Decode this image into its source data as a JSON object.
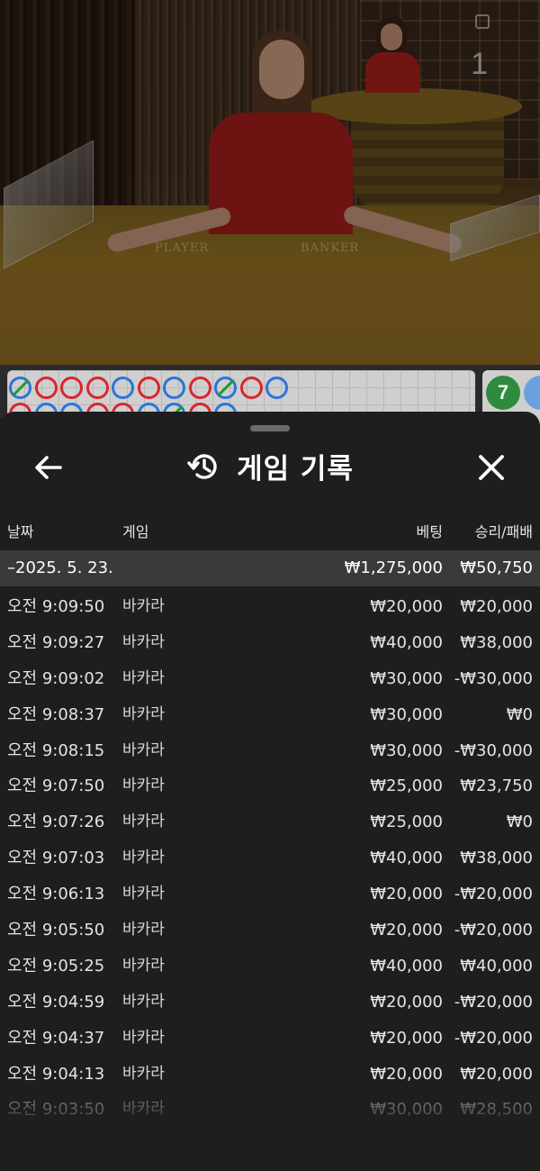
{
  "video": {
    "table_number": "1",
    "felt_labels": [
      "PLAYER",
      "BANKER"
    ]
  },
  "roadmap": {
    "row1": [
      "b",
      "r",
      "r",
      "r",
      "b",
      "r",
      "b",
      "r",
      "b",
      "r",
      "b"
    ],
    "row2": [
      "r",
      "b",
      "b",
      "r",
      "r",
      "b",
      "b",
      "r",
      "b"
    ],
    "side_badge": "7"
  },
  "sheet": {
    "title": "게임 기록",
    "icons": {
      "back": "arrow-left-icon",
      "history": "history-icon",
      "close": "close-icon"
    },
    "columns": {
      "date": "날짜",
      "game": "게임",
      "bet": "베팅",
      "result": "승리/패배"
    },
    "date_group": {
      "label": "–2025. 5. 23.",
      "bet": "₩1,275,000",
      "result": "₩50,750"
    },
    "rows": [
      {
        "time": "오전 9:09:50",
        "game": "바카라",
        "bet": "₩20,000",
        "result": "₩20,000"
      },
      {
        "time": "오전 9:09:27",
        "game": "바카라",
        "bet": "₩40,000",
        "result": "₩38,000"
      },
      {
        "time": "오전 9:09:02",
        "game": "바카라",
        "bet": "₩30,000",
        "result": "-₩30,000"
      },
      {
        "time": "오전 9:08:37",
        "game": "바카라",
        "bet": "₩30,000",
        "result": "₩0"
      },
      {
        "time": "오전 9:08:15",
        "game": "바카라",
        "bet": "₩30,000",
        "result": "-₩30,000"
      },
      {
        "time": "오전 9:07:50",
        "game": "바카라",
        "bet": "₩25,000",
        "result": "₩23,750"
      },
      {
        "time": "오전 9:07:26",
        "game": "바카라",
        "bet": "₩25,000",
        "result": "₩0"
      },
      {
        "time": "오전 9:07:03",
        "game": "바카라",
        "bet": "₩40,000",
        "result": "₩38,000"
      },
      {
        "time": "오전 9:06:13",
        "game": "바카라",
        "bet": "₩20,000",
        "result": "-₩20,000"
      },
      {
        "time": "오전 9:05:50",
        "game": "바카라",
        "bet": "₩20,000",
        "result": "-₩20,000"
      },
      {
        "time": "오전 9:05:25",
        "game": "바카라",
        "bet": "₩40,000",
        "result": "₩40,000"
      },
      {
        "time": "오전 9:04:59",
        "game": "바카라",
        "bet": "₩20,000",
        "result": "-₩20,000"
      },
      {
        "time": "오전 9:04:37",
        "game": "바카라",
        "bet": "₩20,000",
        "result": "-₩20,000"
      },
      {
        "time": "오전 9:04:13",
        "game": "바카라",
        "bet": "₩20,000",
        "result": "₩20,000"
      },
      {
        "time": "오전 9:03:50",
        "game": "바카라",
        "bet": "₩30,000",
        "result": "₩28,500"
      }
    ]
  }
}
